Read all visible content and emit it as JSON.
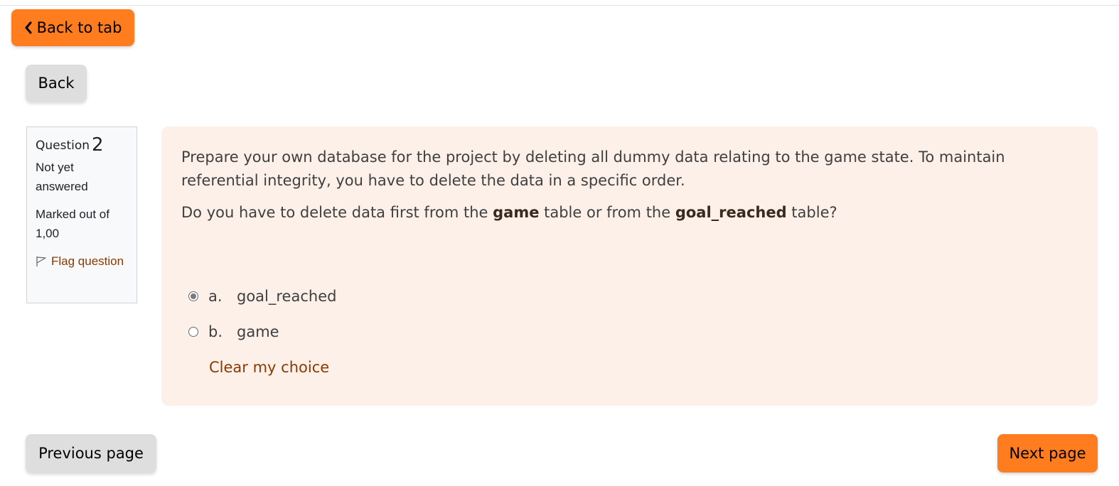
{
  "nav": {
    "back_to_tab_label": "Back to tab",
    "back_label": "Back",
    "previous_page_label": "Previous page",
    "next_page_label": "Next page"
  },
  "question_info": {
    "title_prefix": "Question",
    "number": "2",
    "state": "Not yet answered",
    "grade": "Marked out of 1,00",
    "flag_label": "Flag question"
  },
  "question": {
    "text_1": "Prepare your own database for the project by deleting all dummy data relating to the game state. To maintain referential integrity, you have to delete the data in a specific order.",
    "text_2_prefix": "Do you have to delete data first from the ",
    "text_2_bold_1": "game",
    "text_2_middle": " table or from the ",
    "text_2_bold_2": "goal_reached",
    "text_2_suffix": " table?",
    "answers": [
      {
        "letter": "a.",
        "label": "goal_reached",
        "selected": true
      },
      {
        "letter": "b.",
        "label": "game",
        "selected": false
      }
    ],
    "clear_label": "Clear my choice"
  },
  "colors": {
    "accent": "#ff7c1f",
    "card_background": "#fdf0e9",
    "link": "#8a3a00"
  },
  "icons": {
    "back_to_tab": "chevron-left-icon",
    "flag": "flag-icon"
  }
}
